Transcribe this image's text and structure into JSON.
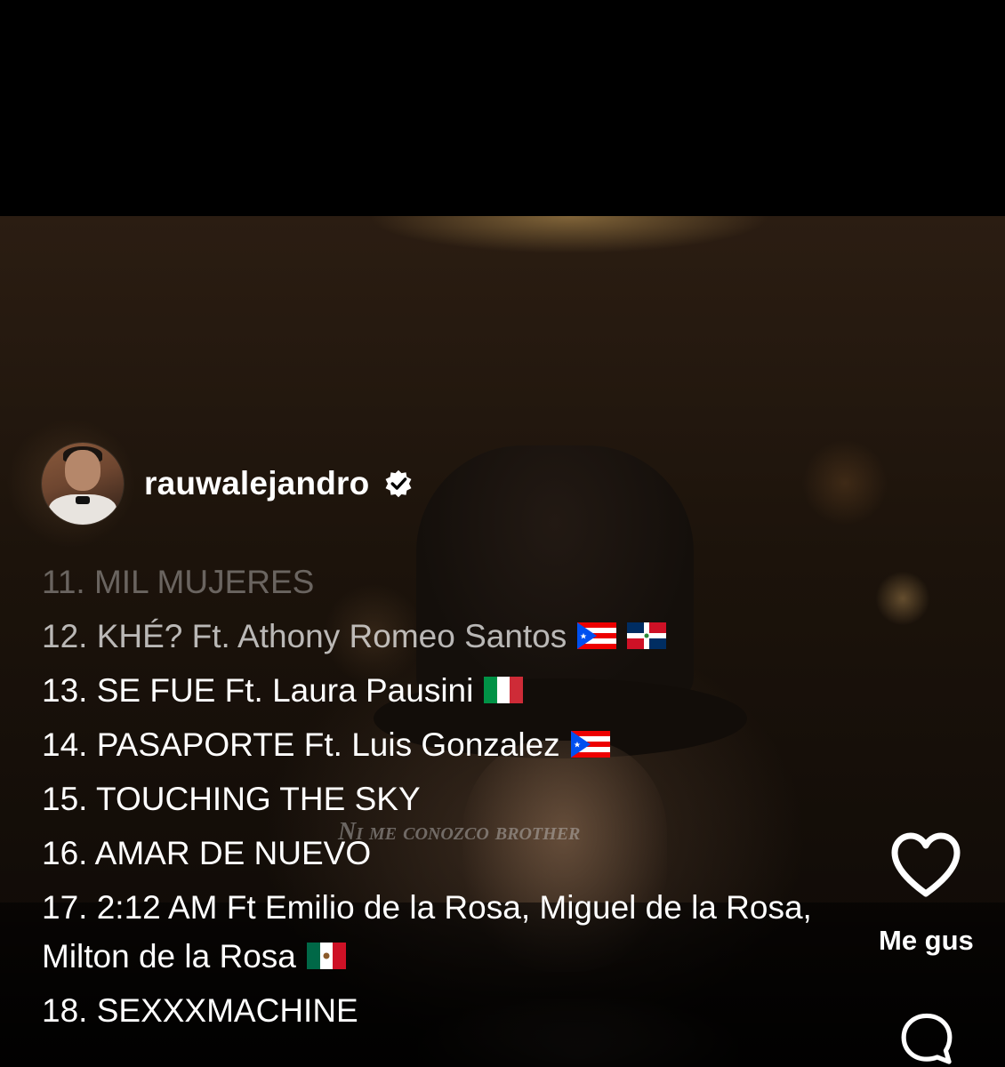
{
  "post": {
    "username": "rauwalejandro",
    "verified": true
  },
  "video": {
    "subtitle": "Ni me conozco brother"
  },
  "tracks": [
    {
      "text": "11. MIL MUJERES",
      "flags": []
    },
    {
      "text": "12. KHÉ? Ft. Athony Romeo Santos",
      "flags": [
        "puerto-rico-flag",
        "dominican-republic-flag"
      ]
    },
    {
      "text": "13. SE FUE Ft. Laura Pausini",
      "flags": [
        "italy-flag"
      ]
    },
    {
      "text": "14. PASAPORTE Ft. Luis Gonzalez",
      "flags": [
        "puerto-rico-flag"
      ]
    },
    {
      "text": "15. TOUCHING THE SKY",
      "flags": []
    },
    {
      "text": "16. AMAR DE NUEVO",
      "flags": []
    },
    {
      "text": "17. 2:12 AM Ft Emilio de la Rosa, Miguel de la Rosa, Milton de la Rosa",
      "flags": [
        "mexico-flag"
      ]
    },
    {
      "text": "18. SEXXXMACHINE",
      "flags": []
    }
  ],
  "actions": {
    "like_label": "Me gus",
    "like_icon": "heart-icon",
    "comment_icon": "comment-icon"
  },
  "colors": {
    "background": "#000000",
    "text": "#ffffff"
  }
}
